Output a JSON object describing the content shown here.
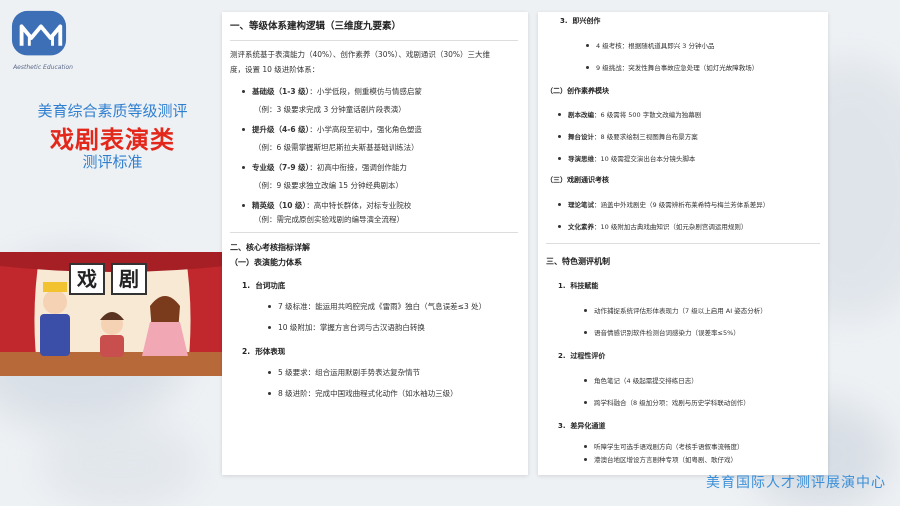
{
  "logo": {
    "caption": "Aesthetic Education"
  },
  "left": {
    "title_1": "美育综合素质等级测评",
    "title_2": "戏剧表演类",
    "title_3": "测评标准"
  },
  "cartoon": {
    "char_1": "戏",
    "char_2": "剧"
  },
  "footer": {
    "org": "美育国际人才测评展演中心"
  },
  "doc_left": {
    "section_1": {
      "heading": "一、等级体系建构逻辑（三维度九要素）",
      "intro_1": "测评系统基于表演能力（40%）、创作素养（30%）、戏剧通识（30%）三大维",
      "intro_2": "度，设置 10 级进阶体系：",
      "levels": [
        {
          "term": "基础级（1-3 级）",
          "desc": "：小学低段，侧重模仿与情感启蒙",
          "example": "（例：3 级要求完成 3 分钟童话剧片段表演）"
        },
        {
          "term": "提升级（4-6 级）",
          "desc": "：小学高段至初中，强化角色塑造",
          "example": "（例：6 级需掌握斯坦尼斯拉夫斯基基础训练法）"
        },
        {
          "term": "专业级（7-9 级）",
          "desc": "：初高中衔接，强调创作能力",
          "example": "（例：9 级要求独立改编 15 分钟经典剧本）"
        },
        {
          "term": "精英级（10 级）",
          "desc": "：高中特长群体，对标专业院校",
          "example": "（例：需完成原创实验戏剧的编导演全流程）"
        }
      ]
    },
    "section_2": {
      "heading": "二、核心考核指标详解",
      "sub_1": "（一）表演能力体系",
      "items": [
        {
          "num": "1.",
          "title": "台词功底",
          "bullets": [
            "7 级标准：能运用共鸣腔完成《雷雨》独白（气息误差≤3 处）",
            "10 级附加：掌握方言台词与古汉语韵白转换"
          ]
        },
        {
          "num": "2.",
          "title": "形体表现",
          "bullets": [
            "5 级要求：组合运用默剧手势表达复杂情节",
            "8 级进阶：完成中国戏曲程式化动作（如水袖功三级）"
          ]
        }
      ]
    }
  },
  "doc_right": {
    "item_3": {
      "num": "3.",
      "title": "即兴创作",
      "bullets": [
        "4 级考核：根据随机道具即兴 3 分钟小品",
        "9 级挑战：突发性舞台事故应急处理（如灯光故障救场）"
      ]
    },
    "sub_2": {
      "heading": "（二）创作素养模块",
      "rows": [
        {
          "term": "剧本改编",
          "desc": "：6 级需将 500 字散文改编为独幕剧"
        },
        {
          "term": "舞台设计",
          "desc": "：8 级要求绘制三视图舞台布景方案"
        },
        {
          "term": "导演思维",
          "desc": "：10 级需提交演出台本分镜头脚本"
        }
      ]
    },
    "sub_3": {
      "heading": "（三）戏剧通识考核",
      "rows": [
        {
          "term": "理论笔试",
          "desc": "：涵盖中外戏剧史（9 级需辨析布莱希特与梅兰芳体系差异）"
        },
        {
          "term": "文化素养",
          "desc": "：10 级附加古典戏曲知识（如元杂剧宫调运用规则）"
        }
      ]
    },
    "section_3": {
      "heading": "三、特色测评机制",
      "items": [
        {
          "num": "1.",
          "title": "科技赋能",
          "bullets": [
            "动作捕捉系统评估形体表现力（7 级以上启用 AI 姿态分析）",
            "语音情感识别软件检测台词感染力（误差率≤5%）"
          ]
        },
        {
          "num": "2.",
          "title": "过程性评价",
          "bullets": [
            "角色笔记（4 级起需提交排练日志）",
            "跨学科融合（8 级加分项：戏剧与历史学科联动创作）"
          ]
        },
        {
          "num": "3.",
          "title": "差异化通道",
          "bullets": [
            "听障学生可选手语戏剧方向（考核手语叙事流畅度）",
            "港澳台地区增设方言剧种专项（如粤剧、歌仔戏）"
          ]
        }
      ]
    }
  }
}
